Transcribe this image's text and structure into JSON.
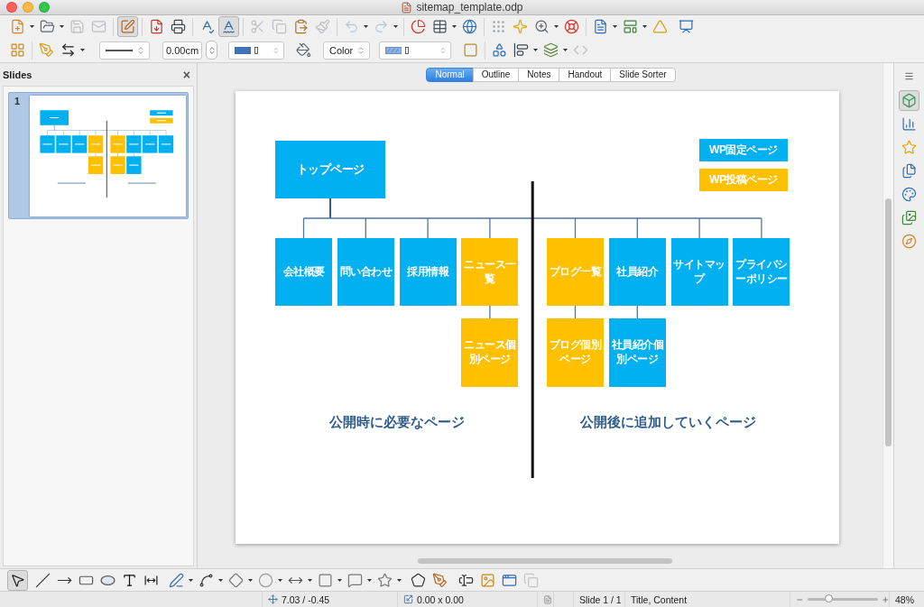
{
  "window": {
    "title": "sitemap_template.odp"
  },
  "standard_toolbar": [
    {
      "pressed": false,
      "disabled": false
    },
    {
      "pressed": false,
      "disabled": false
    },
    {
      "pressed": false,
      "disabled": true
    },
    {
      "pressed": false,
      "disabled": true
    },
    {
      "pressed": true,
      "disabled": false
    },
    {
      "pressed": false,
      "disabled": false
    },
    {
      "pressed": false,
      "disabled": false
    },
    {
      "pressed": false,
      "disabled": false
    },
    {
      "pressed": true,
      "disabled": false
    },
    {
      "pressed": false,
      "disabled": true
    },
    {
      "pressed": false,
      "disabled": true
    },
    {
      "pressed": false,
      "disabled": false
    },
    {
      "pressed": false,
      "disabled": true
    },
    {
      "pressed": false,
      "disabled": true
    },
    {
      "pressed": false,
      "disabled": true
    },
    {
      "pressed": false,
      "disabled": false
    },
    {
      "pressed": false,
      "disabled": false
    },
    {
      "pressed": false,
      "disabled": false
    },
    {
      "pressed": false,
      "disabled": false
    },
    {
      "pressed": false,
      "disabled": false
    },
    {
      "pressed": false,
      "disabled": false
    },
    {
      "pressed": false,
      "disabled": false
    },
    {
      "pressed": false,
      "disabled": false
    },
    {
      "pressed": false,
      "disabled": false
    },
    {
      "pressed": false,
      "disabled": false
    },
    {
      "pressed": false,
      "disabled": false
    }
  ],
  "line_fill_toolbar": {
    "buttons": [
      {
        "disabled": false
      },
      {
        "disabled": false
      },
      {
        "disabled": false
      },
      {
        "disabled": false
      },
      {
        "disabled": false
      },
      {
        "disabled": false
      },
      {
        "disabled": false
      },
      {
        "disabled": false
      },
      {
        "disabled": true
      }
    ],
    "line_width": "0.00cm",
    "area_style": "Color"
  },
  "slides_panel": {
    "title": "Slides",
    "close": "×",
    "slides": [
      {
        "number": "1",
        "selected": true
      }
    ]
  },
  "view_tabs": [
    {
      "label": "Normal",
      "selected": true
    },
    {
      "label": "Outline",
      "selected": false
    },
    {
      "label": "Notes",
      "selected": false
    },
    {
      "label": "Handout",
      "selected": false
    },
    {
      "label": "Slide Sorter",
      "selected": false
    }
  ],
  "slide": {
    "sitemap": {
      "label": "トップページ",
      "color": "#00b0f0",
      "children": [
        {
          "label": "会社概要",
          "color": "#00b0f0"
        },
        {
          "label": "問い合わせ",
          "color": "#00b0f0"
        },
        {
          "label": "採用情報",
          "color": "#00b0f0"
        },
        {
          "label": "ニュース一覧",
          "color": "#ffc000",
          "children": [
            {
              "label": "ニュース個別ページ",
              "color": "#ffc000"
            }
          ]
        },
        {
          "label": "ブログ一覧",
          "color": "#ffc000",
          "children": [
            {
              "label": "ブログ個別ページ",
              "color": "#ffc000"
            }
          ]
        },
        {
          "label": "社員紹介",
          "color": "#00b0f0",
          "children": [
            {
              "label": "社員紹介個別ページ",
              "color": "#00b0f0"
            }
          ]
        },
        {
          "label": "サイトマップ",
          "color": "#00b0f0"
        },
        {
          "label": "プライバシーポリシー",
          "color": "#00b0f0"
        }
      ]
    },
    "legend": [
      {
        "label": "WP固定ページ",
        "color": "#00b0f0"
      },
      {
        "label": "WP投稿ページ",
        "color": "#ffc000"
      }
    ],
    "captions": [
      "公開時に必要なページ",
      "公開後に追加していくページ"
    ]
  },
  "sidebar": {
    "buttons": [
      {
        "selected": true
      },
      {
        "selected": false
      },
      {
        "selected": false
      },
      {
        "selected": false
      },
      {
        "selected": false
      },
      {
        "selected": false
      },
      {
        "selected": false
      }
    ]
  },
  "drawing_toolbar": [
    {
      "pressed": true,
      "disabled": false
    },
    {
      "pressed": false,
      "disabled": false
    },
    {
      "pressed": false,
      "disabled": false
    },
    {
      "pressed": false,
      "disabled": false
    },
    {
      "pressed": false,
      "disabled": false
    },
    {
      "pressed": false,
      "disabled": false
    },
    {
      "pressed": false,
      "disabled": false
    },
    {
      "pressed": false,
      "disabled": false
    },
    {
      "pressed": false,
      "disabled": false
    },
    {
      "pressed": false,
      "disabled": false
    },
    {
      "pressed": false,
      "disabled": false
    },
    {
      "pressed": false,
      "disabled": false
    },
    {
      "pressed": false,
      "disabled": false
    },
    {
      "pressed": false,
      "disabled": false
    },
    {
      "pressed": false,
      "disabled": false
    },
    {
      "pressed": false,
      "disabled": false
    },
    {
      "pressed": false,
      "disabled": false
    },
    {
      "pressed": false,
      "disabled": false
    },
    {
      "pressed": false,
      "disabled": false
    },
    {
      "pressed": false,
      "disabled": false
    },
    {
      "pressed": false,
      "disabled": true
    }
  ],
  "status_bar": {
    "position": "7.03 / -0.45",
    "size": "0.00 x 0.00",
    "slide": "Slide 1 / 1",
    "layout": "Title, Content",
    "zoom": {
      "level": 0.3
    },
    "zoom_percent": "48%"
  }
}
